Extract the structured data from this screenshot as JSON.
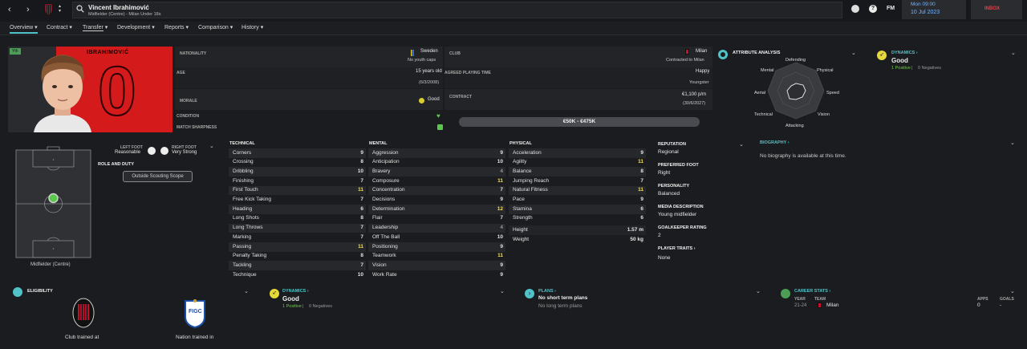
{
  "header": {
    "player_name": "Vincent Ibrahimović",
    "player_sub": "Midfielder (Centre) - Milan Under 18s",
    "fm_label": "FM",
    "date_day": "Mon 09:00",
    "date_full": "10 Jul 2023",
    "inbox": "INBOX"
  },
  "nav": {
    "tabs": [
      "Overview",
      "Contract",
      "Transfer",
      "Development",
      "Reports",
      "Comparison",
      "History"
    ]
  },
  "profile": {
    "shirt_name": "IBRAHIMOVIĆ",
    "shirt_number": "0",
    "badge_text": "Yth"
  },
  "info": {
    "nationality_label": "NATIONALITY",
    "nationality": "Sweden",
    "youth_caps": "No youth caps",
    "age_label": "AGE",
    "age": "15 years old",
    "dob": "(6/3/2008)",
    "morale_label": "MORALE",
    "morale": "Good",
    "condition_label": "CONDITION",
    "sharpness_label": "MATCH SHARPNESS",
    "club_label": "CLUB",
    "club": "Milan",
    "club_status": "Contracted to Milan",
    "playing_time_label": "AGREED PLAYING TIME",
    "playing_time": "Happy",
    "playing_time_sub": "Youngster",
    "contract_label": "CONTRACT",
    "wage": "€1,100 p/m",
    "contract_end": "(30/6/2027)",
    "value": "€50K - €475K"
  },
  "attribute_analysis": {
    "title": "ATTRIBUTE ANALYSIS",
    "labels": [
      "Defending",
      "Physical",
      "Speed",
      "Vision",
      "Attacking",
      "Technical",
      "Aerial",
      "Mental"
    ]
  },
  "dynamics_top": {
    "title": "DYNAMICS",
    "status": "Good",
    "positive": "1 Positive",
    "separator": "|",
    "negative": "0 Negatives"
  },
  "pitch": {
    "left_foot_label": "LEFT FOOT",
    "left_foot": "Reasonable",
    "right_foot_label": "RIGHT FOOT",
    "right_foot": "Very Strong",
    "role_label": "ROLE AND DUTY",
    "scouting_button": "Outside Scouting Scope",
    "position": "Midfielder (Centre)"
  },
  "technical": {
    "title": "TECHNICAL",
    "rows": [
      {
        "name": "Corners",
        "value": "9"
      },
      {
        "name": "Crossing",
        "value": "8"
      },
      {
        "name": "Dribbling",
        "value": "10"
      },
      {
        "name": "Finishing",
        "value": "7"
      },
      {
        "name": "First Touch",
        "value": "11"
      },
      {
        "name": "Free Kick Taking",
        "value": "7"
      },
      {
        "name": "Heading",
        "value": "6"
      },
      {
        "name": "Long Shots",
        "value": "8"
      },
      {
        "name": "Long Throws",
        "value": "7"
      },
      {
        "name": "Marking",
        "value": "7"
      },
      {
        "name": "Passing",
        "value": "11"
      },
      {
        "name": "Penalty Taking",
        "value": "8"
      },
      {
        "name": "Tackling",
        "value": "7"
      },
      {
        "name": "Technique",
        "value": "10"
      }
    ]
  },
  "mental": {
    "title": "MENTAL",
    "rows": [
      {
        "name": "Aggression",
        "value": "9"
      },
      {
        "name": "Anticipation",
        "value": "10"
      },
      {
        "name": "Bravery",
        "value": "4"
      },
      {
        "name": "Composure",
        "value": "11"
      },
      {
        "name": "Concentration",
        "value": "7"
      },
      {
        "name": "Decisions",
        "value": "9"
      },
      {
        "name": "Determination",
        "value": "12"
      },
      {
        "name": "Flair",
        "value": "7"
      },
      {
        "name": "Leadership",
        "value": "4"
      },
      {
        "name": "Off The Ball",
        "value": "10"
      },
      {
        "name": "Positioning",
        "value": "9"
      },
      {
        "name": "Teamwork",
        "value": "11"
      },
      {
        "name": "Vision",
        "value": "9"
      },
      {
        "name": "Work Rate",
        "value": "9"
      }
    ]
  },
  "physical": {
    "title": "PHYSICAL",
    "rows": [
      {
        "name": "Acceleration",
        "value": "9"
      },
      {
        "name": "Agility",
        "value": "11"
      },
      {
        "name": "Balance",
        "value": "8"
      },
      {
        "name": "Jumping Reach",
        "value": "7"
      },
      {
        "name": "Natural Fitness",
        "value": "11"
      },
      {
        "name": "Pace",
        "value": "9"
      },
      {
        "name": "Stamina",
        "value": "6"
      },
      {
        "name": "Strength",
        "value": "6"
      }
    ],
    "height_label": "Height",
    "height": "1.57 m",
    "weight_label": "Weight",
    "weight": "50 kg"
  },
  "side_info": {
    "reputation_label": "REPUTATION",
    "reputation": "Regional",
    "preferred_foot_label": "PREFERRED FOOT",
    "preferred_foot": "Right",
    "personality_label": "PERSONALITY",
    "personality": "Balanced",
    "media_label": "MEDIA DESCRIPTION",
    "media": "Young midfielder",
    "gk_label": "GOALKEEPER RATING",
    "gk": "2",
    "traits_label": "PLAYER TRAITS",
    "traits": "None"
  },
  "biography": {
    "title": "BIOGRAPHY",
    "text": "No biography is available at this time."
  },
  "eligibility": {
    "title": "ELIGIBILITY",
    "club_trained": "Club trained at",
    "nation_trained": "Nation trained in",
    "figc": "FIGC"
  },
  "dynamics_bottom": {
    "title": "DYNAMICS",
    "status": "Good",
    "positive": "1 Positive",
    "separator": "|",
    "negative": "0 Negatives"
  },
  "plans": {
    "title": "PLANS",
    "short": "No short term plans",
    "long": "No long term plans"
  },
  "career": {
    "title": "CAREER STATS",
    "year_label": "YEAR",
    "team_label": "TEAM",
    "apps_label": "APPS",
    "goals_label": "GOALS",
    "year": "21-24",
    "team": "Milan",
    "apps": "0",
    "goals": "-"
  },
  "colors": {
    "accent": "#4fc3c8",
    "highlight": "#f4e24b",
    "positive": "#6fce4a",
    "inbox": "#e0404a",
    "date": "#6fb6ff",
    "shirt": "#d41a1a"
  }
}
